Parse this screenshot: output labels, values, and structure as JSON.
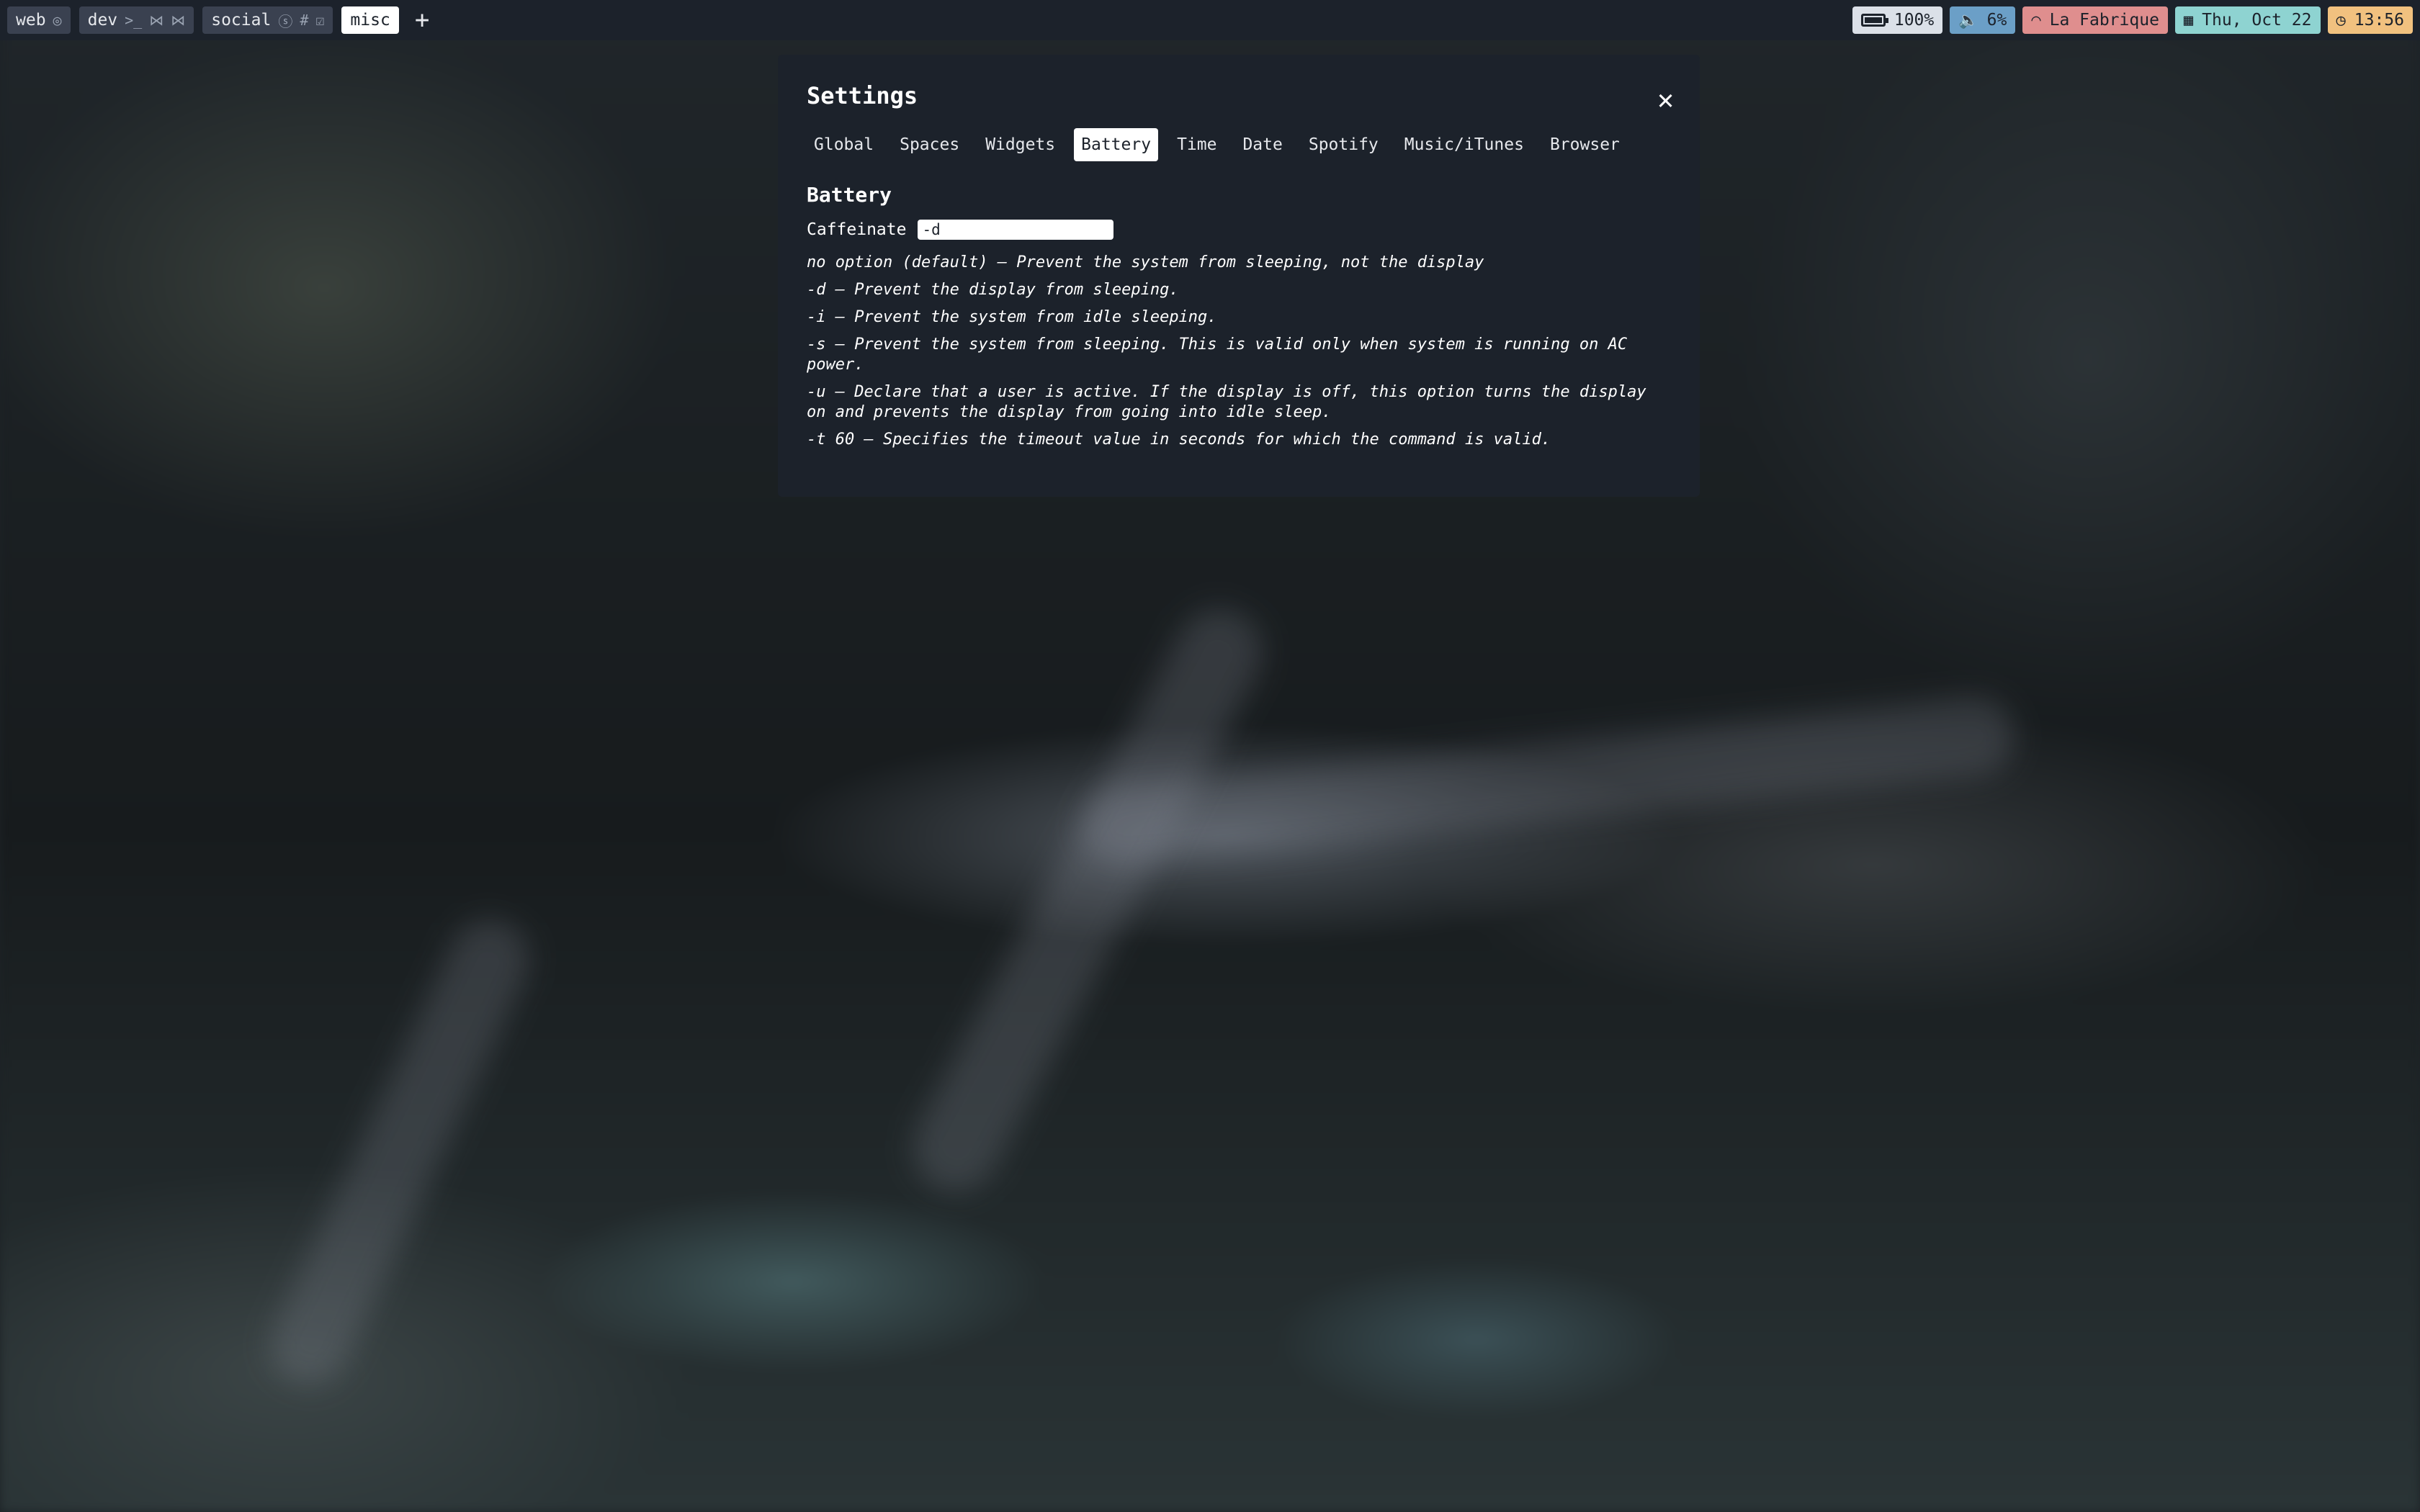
{
  "topbar": {
    "spaces": [
      {
        "label": "web",
        "icons": [
          "chrome-icon"
        ]
      },
      {
        "label": "dev",
        "icons": [
          "terminal-icon",
          "vscode-icon",
          "vscode-icon"
        ]
      },
      {
        "label": "social",
        "icons": [
          "skype-icon",
          "slack-icon",
          "check-icon"
        ]
      },
      {
        "label": "misc",
        "icons": [],
        "active": true
      }
    ],
    "add_label": "+",
    "status": {
      "battery": "100%",
      "battery_level": 1.0,
      "volume": "6%",
      "wifi": "La Fabrique",
      "date": "Thu, Oct 22",
      "time": "13:56"
    },
    "colors": {
      "battery": "#dbe0e8",
      "volume": "#6b9fc7",
      "wifi": "#df8e8e",
      "date": "#8ed3d1",
      "time": "#f1c17f"
    }
  },
  "settings": {
    "title": "Settings",
    "close_label": "✕",
    "tabs": [
      "Global",
      "Spaces",
      "Widgets",
      "Battery",
      "Time",
      "Date",
      "Spotify",
      "Music/iTunes",
      "Browser"
    ],
    "active_tab": "Battery",
    "section_title": "Battery",
    "caffeinate_label": "Caffeinate",
    "caffeinate_value": "-d",
    "help_lines": [
      "no option (default) — Prevent the system from sleeping, not the display",
      "-d — Prevent the display from sleeping.",
      "-i — Prevent the system from idle sleeping.",
      "-s — Prevent the system from sleeping. This is valid only when system is running on AC power.",
      "-u — Declare that a user is active. If the display is off, this option turns the display on and prevents the display from going into idle sleep.",
      "-t 60 — Specifies the timeout value in seconds for which the command is valid."
    ]
  }
}
